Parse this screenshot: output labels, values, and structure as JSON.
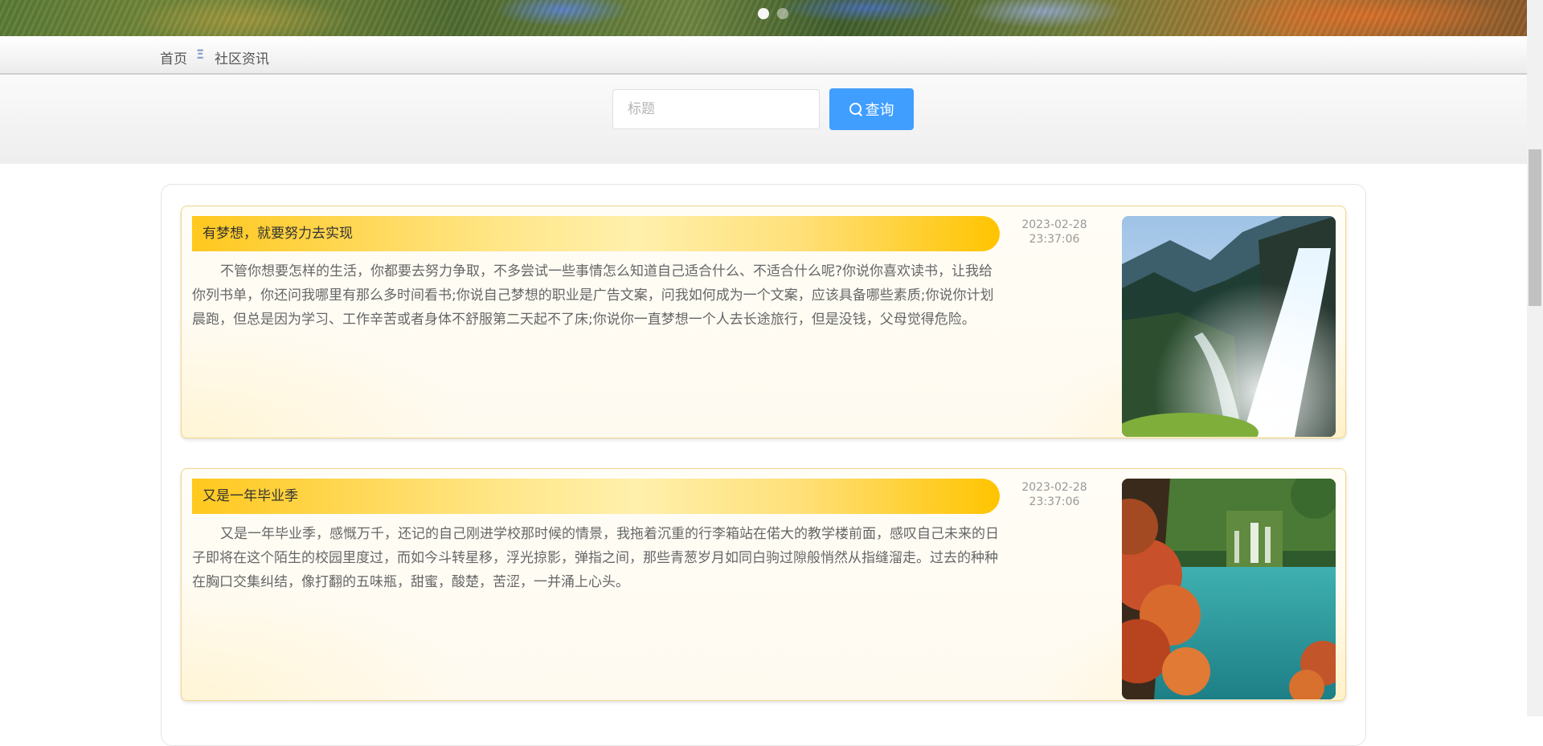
{
  "banner": {
    "carousel_dots": 2
  },
  "breadcrumb": {
    "home_label": "首页",
    "separator": "Ξ",
    "current_label": "社区资讯"
  },
  "search": {
    "placeholder": "标题",
    "value": "",
    "button_label": "查询",
    "button_color": "#409eff"
  },
  "articles": [
    {
      "title": "有梦想，就要努力去实现",
      "date": "2023-02-28",
      "time": "23:37:06",
      "body": "不管你想要怎样的生活，你都要去努力争取，不多尝试一些事情怎么知道自己适合什么、不适合什么呢?你说你喜欢读书，让我给你列书单，你还问我哪里有那么多时间看书;你说自己梦想的职业是广告文案，问我如何成为一个文案，应该具备哪些素质;你说你计划晨跑，但总是因为学习、工作辛苦或者身体不舒服第二天起不了床;你说你一直梦想一个人去长途旅行，但是没钱，父母觉得危险。",
      "image": "waterfall-image"
    },
    {
      "title": "又是一年毕业季",
      "date": "2023-02-28",
      "time": "23:37:06",
      "body": "又是一年毕业季，感慨万千，还记的自己刚进学校那时候的情景，我拖着沉重的行李箱站在偌大的教学楼前面，感叹自己未来的日子即将在这个陌生的校园里度过，而如今斗转星移，浮光掠影，弹指之间，那些青葱岁月如同白驹过隙般悄然从指缝溜走。过去的种种在胸口交集纠结，像打翻的五味瓶，甜蜜，酸楚，苦涩，一并涌上心头。",
      "image": "lake-image"
    }
  ],
  "colors": {
    "title_bar_gold": "#ffc81e",
    "card_border": "#f2d58a"
  }
}
